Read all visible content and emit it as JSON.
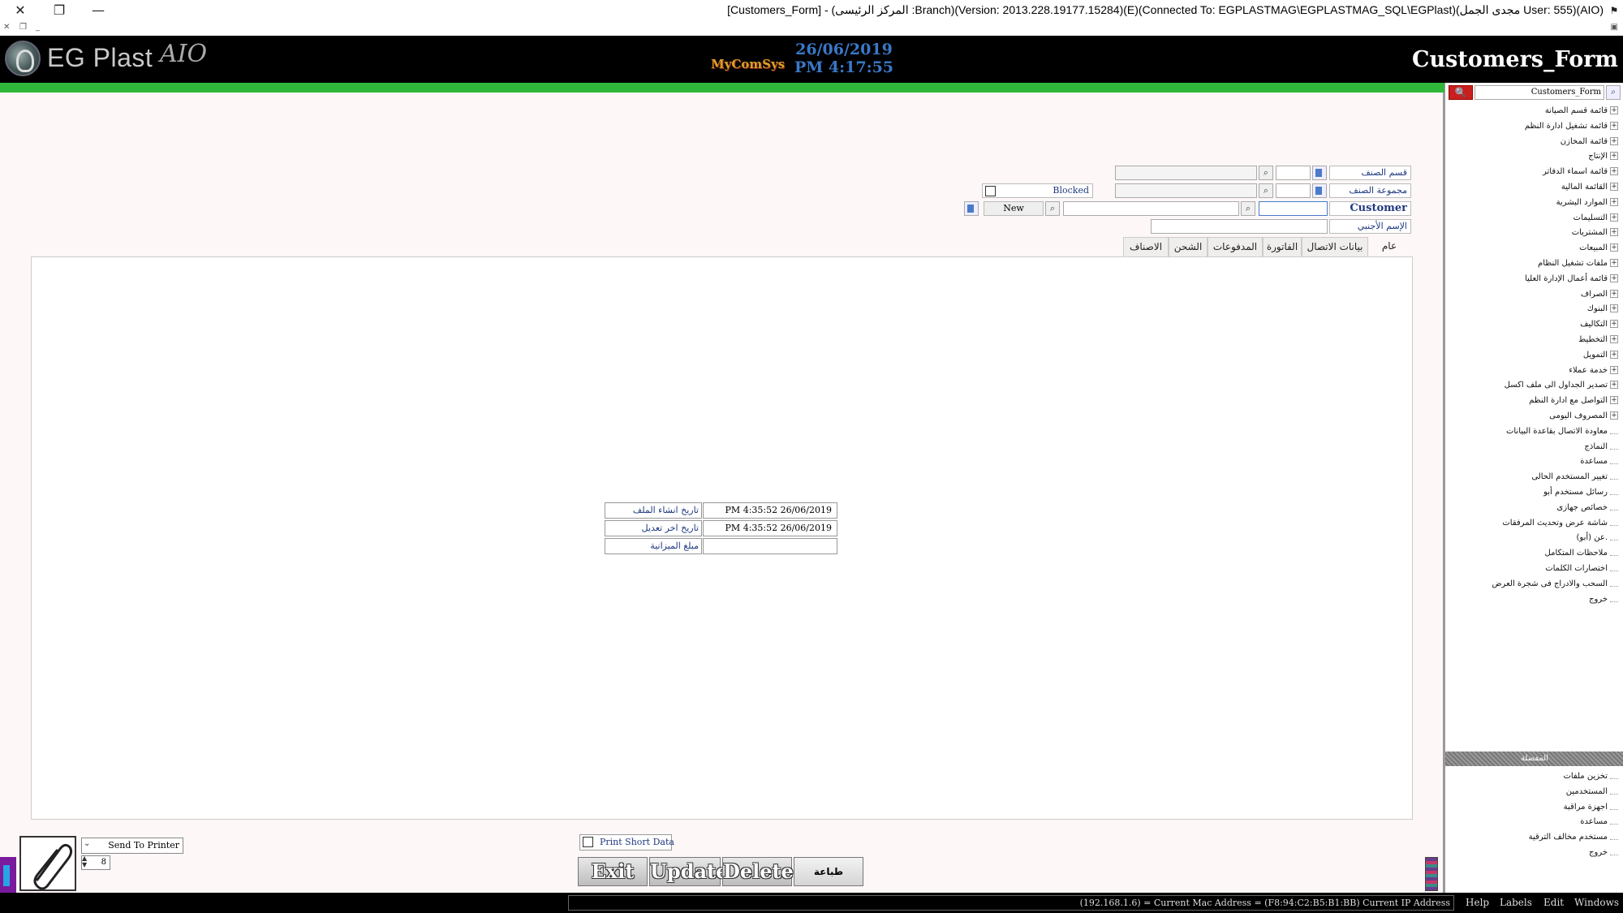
{
  "window": {
    "title": "[Customers_Form] - (المركز الرئيسى :Branch)(Version: 2013.228.19177.15284)(E)(Connected To: EGPLASTMAG\\EGPLASTMAG_SQL\\EGPlast)(مجدى الجمل User: 555)(AIO)"
  },
  "header": {
    "brand": "EG Plast",
    "brand_suffix": "AIO",
    "vendor_logo": "MyComSys",
    "date": "26/06/2019",
    "time": "PM 4:17:55",
    "form_name": "Customers_Form"
  },
  "form": {
    "category_label": "قسم الصنف",
    "group_label": "مجموعة الصنف",
    "customer_label": "Customer",
    "foreign_name_label": "الإسم الأجنبي",
    "blocked_label": "Blocked",
    "new_button": "New"
  },
  "tabs": [
    {
      "label": "عام"
    },
    {
      "label": "بيانات الاتصال"
    },
    {
      "label": "الفاتورة"
    },
    {
      "label": "المدفوعات"
    },
    {
      "label": "الشحن"
    },
    {
      "label": "الاصناف"
    }
  ],
  "info": {
    "created_label": "تاريخ انشاء الملف",
    "created_value": "PM 4:35:52 26/06/2019",
    "modified_label": "تاريخ اخر تعديل",
    "modified_value": "PM 4:35:52 26/06/2019",
    "budget_label": "مبلغ الميزانية",
    "budget_value": ""
  },
  "footer": {
    "send_to_printer": "Send To Printer",
    "copies": "8",
    "print_short_data": "Print Short Data",
    "exit": "Exit",
    "update": "Update",
    "delete": "Delete",
    "print": "طباعة"
  },
  "sidebar": {
    "search_value": "Customers_Form",
    "tree": [
      {
        "label": "قائمة قسم الصيانة",
        "expandable": true
      },
      {
        "label": "قائمة تشغيل ادارة النظم",
        "expandable": true
      },
      {
        "label": "قائمة المخازن",
        "expandable": true
      },
      {
        "label": "الإنتاج",
        "expandable": true
      },
      {
        "label": "قائمة اسماء الدفاتر",
        "expandable": true
      },
      {
        "label": "القائمة المالية",
        "expandable": true
      },
      {
        "label": "الموارد البشرية",
        "expandable": true
      },
      {
        "label": "التسليمات",
        "expandable": true
      },
      {
        "label": "المشتريات",
        "expandable": true
      },
      {
        "label": "المبيعات",
        "expandable": true
      },
      {
        "label": "ملفات تشغيل النظام",
        "expandable": true
      },
      {
        "label": "قائمة أعمال الإدارة العليا",
        "expandable": true
      },
      {
        "label": "الصراف",
        "expandable": true
      },
      {
        "label": "البنوك",
        "expandable": true
      },
      {
        "label": "التكاليف",
        "expandable": true
      },
      {
        "label": "التخطيط",
        "expandable": true
      },
      {
        "label": "التمويل",
        "expandable": true
      },
      {
        "label": "خدمة عملاء",
        "expandable": true
      },
      {
        "label": "تصدير الجداول الى ملف اكسل",
        "expandable": true
      },
      {
        "label": "التواصل مع ادارة النظم",
        "expandable": true
      },
      {
        "label": "المصروف اليومى",
        "expandable": true
      },
      {
        "label": "معاودة الاتصال بقاعدة البيانات",
        "expandable": false
      },
      {
        "label": "النماذج",
        "expandable": false
      },
      {
        "label": "مساعدة",
        "expandable": false
      },
      {
        "label": "تغيير المستخدم الحالى",
        "expandable": false
      },
      {
        "label": "رسائل مستخدم أبو",
        "expandable": false
      },
      {
        "label": "خصائص جهازى",
        "expandable": false
      },
      {
        "label": "شاشة عرض وتحديث المرفقات",
        "expandable": false
      },
      {
        "label": "عن (أبو).",
        "expandable": false
      },
      {
        "label": "ملاحظات المتكامل",
        "expandable": false
      },
      {
        "label": "اختصارات الكلمات",
        "expandable": false
      },
      {
        "label": "السحب والادراج فى شجرة العرض",
        "expandable": false
      },
      {
        "label": "خروج",
        "expandable": false
      }
    ],
    "favorites_header": "المفضلة",
    "favorites": [
      {
        "label": "تخزين ملفات"
      },
      {
        "label": "المستخدمين"
      },
      {
        "label": "اجهزة مراقبة"
      },
      {
        "label": "مساعدة"
      },
      {
        "label": "مستخدم مخالف الترقية"
      },
      {
        "label": "خروج"
      }
    ]
  },
  "statusbar": {
    "text": "(192.168.1.6) = Current Mac Address = (F8:94:C2:B5:B1:BB) Current IP Address",
    "menus": [
      "Help",
      "Labels",
      "Edit",
      "Windows"
    ]
  },
  "colors": {
    "accent_green": "#2fb83a",
    "header_bg": "#000000",
    "label_blue": "#203a80",
    "search_red": "#c8201e"
  }
}
